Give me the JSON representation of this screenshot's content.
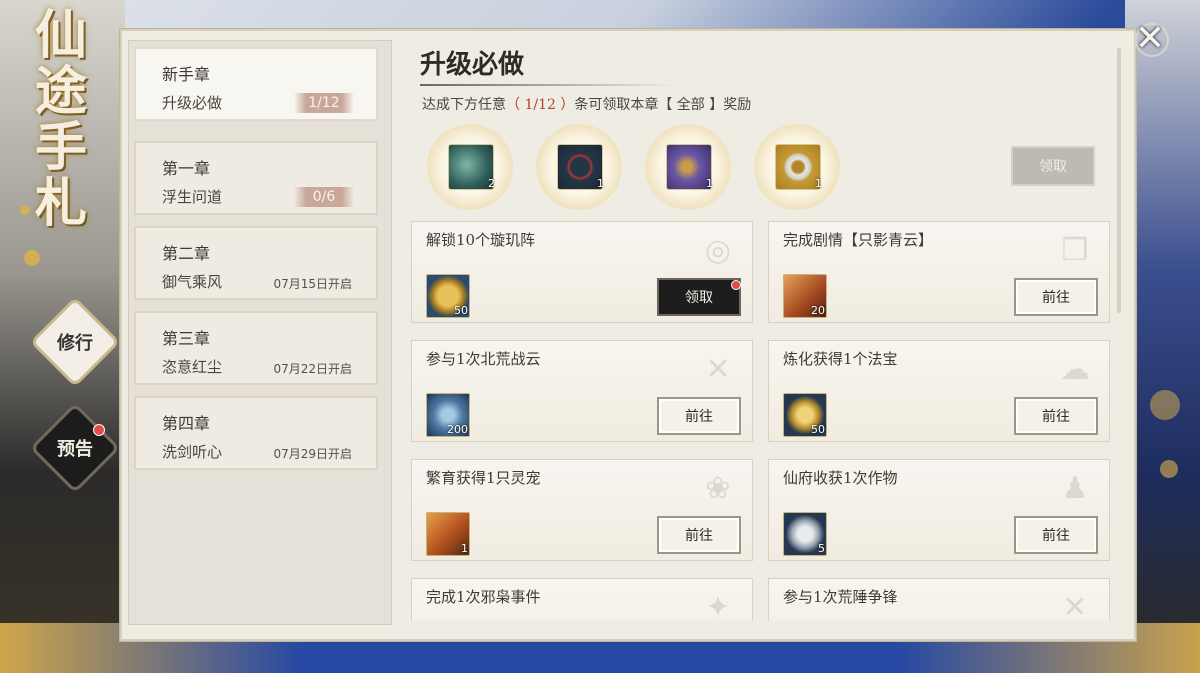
{
  "sidebar": {
    "title_chars": [
      "仙",
      "途",
      "手",
      "札"
    ],
    "buttons": [
      {
        "label": "修行"
      },
      {
        "label": "预告"
      }
    ]
  },
  "chapters": [
    {
      "title": "新手章",
      "subtitle": "升级必做",
      "progress": "1/12",
      "date": ""
    },
    {
      "title": "第一章",
      "subtitle": "浮生问道",
      "progress": "0/6",
      "date": ""
    },
    {
      "title": "第二章",
      "subtitle": "御气乘风",
      "progress": "",
      "date": "07月15日开启"
    },
    {
      "title": "第三章",
      "subtitle": "恣意红尘",
      "progress": "",
      "date": "07月22日开启"
    },
    {
      "title": "第四章",
      "subtitle": "洗剑听心",
      "progress": "",
      "date": "07月29日开启"
    }
  ],
  "main": {
    "title": "升级必做",
    "subtitle_prefix": "达成下方任意",
    "subtitle_highlight": "（ 1/12 ）",
    "subtitle_suffix": "条可领取本章【 全部 】奖励",
    "claim_all_label": "领取"
  },
  "rewards": [
    {
      "icon": "green-pouch-icon",
      "count": "2",
      "color": "#3f6d69"
    },
    {
      "icon": "red-bead-bracelet-icon",
      "count": "1",
      "color": "#2e4257"
    },
    {
      "icon": "purple-pouch-icon",
      "count": "1",
      "color": "#4e3f7d"
    },
    {
      "icon": "jade-ring-icon",
      "count": "1",
      "color": "#b58b2a"
    }
  ],
  "tasks": [
    {
      "title": "解锁10个璇玑阵",
      "reward_icon": "gold-coin-icon",
      "reward_count": "50",
      "button": "领取",
      "claimable": true,
      "deco": "◎",
      "color": "#2c4a6d"
    },
    {
      "title": "完成剧情【只影青云】",
      "reward_icon": "scroll-icon",
      "reward_count": "20",
      "button": "前往",
      "claimable": false,
      "deco": "❐",
      "color": "#7a3b1a"
    },
    {
      "title": "参与1次北荒战云",
      "reward_icon": "spirit-stone-icon",
      "reward_count": "200",
      "button": "前往",
      "claimable": false,
      "deco": "✕",
      "color": "#3a5a7a"
    },
    {
      "title": "炼化获得1个法宝",
      "reward_icon": "gold-ingot-icon",
      "reward_count": "50",
      "button": "前往",
      "claimable": false,
      "deco": "☁",
      "color": "#2c4460"
    },
    {
      "title": "繁育获得1只灵宠",
      "reward_icon": "talisman-icon",
      "reward_count": "1",
      "button": "前往",
      "claimable": false,
      "deco": "❀",
      "color": "#8a3a1a"
    },
    {
      "title": "仙府收获1次作物",
      "reward_icon": "silver-pouch-icon",
      "reward_count": "5",
      "button": "前往",
      "claimable": false,
      "deco": "♟",
      "color": "#2c3f5a"
    },
    {
      "title": "完成1次邪枭事件",
      "reward_icon": "",
      "reward_count": "",
      "button": "",
      "claimable": false,
      "deco": "✦",
      "color": "#444"
    },
    {
      "title": "参与1次荒陲争锋",
      "reward_icon": "",
      "reward_count": "",
      "button": "",
      "claimable": false,
      "deco": "✕",
      "color": "#444"
    }
  ],
  "colors": {
    "accent_red": "#b7402d",
    "claim_button": "#1d1d1d",
    "panel_bg": "#efece4"
  }
}
